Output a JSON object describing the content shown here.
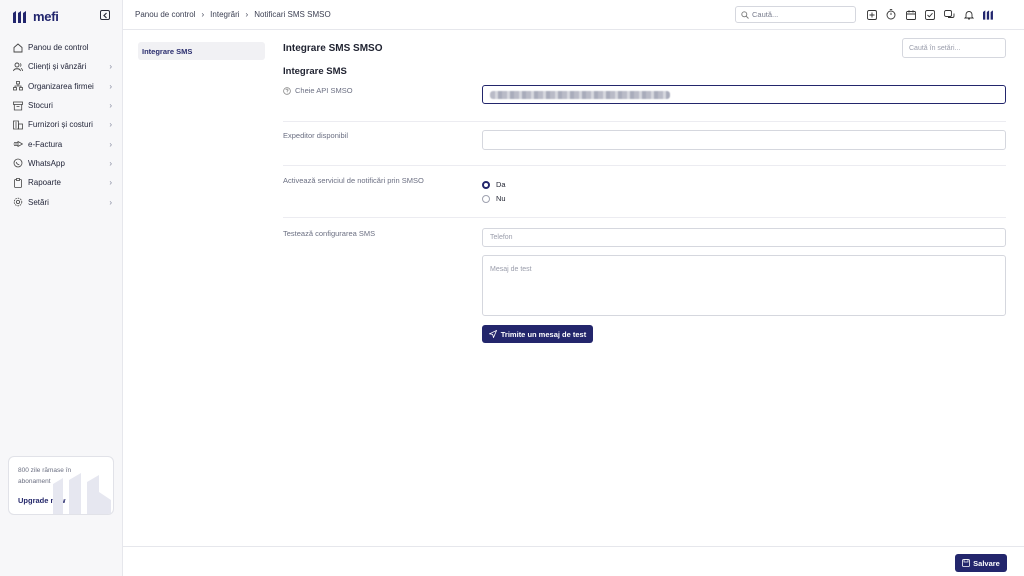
{
  "app": {
    "name": "mefi"
  },
  "sidebar": {
    "items": [
      {
        "label": "Panou de control",
        "icon": "home-icon",
        "chevron": false
      },
      {
        "label": "Clienți și vânzări",
        "icon": "users-icon",
        "chevron": true
      },
      {
        "label": "Organizarea firmei",
        "icon": "org-chart-icon",
        "chevron": true
      },
      {
        "label": "Stocuri",
        "icon": "warehouse-icon",
        "chevron": true
      },
      {
        "label": "Furnizori și costuri",
        "icon": "building-icon",
        "chevron": true
      },
      {
        "label": "e-Factura",
        "icon": "efactura-icon",
        "chevron": true
      },
      {
        "label": "WhatsApp",
        "icon": "whatsapp-icon",
        "chevron": true
      },
      {
        "label": "Rapoarte",
        "icon": "clipboard-icon",
        "chevron": true
      },
      {
        "label": "Setări",
        "icon": "gear-icon",
        "chevron": true
      }
    ],
    "upgrade": {
      "days_text": "800 zile rămase în abonament",
      "link_label": "Upgrade now"
    }
  },
  "header": {
    "breadcrumbs": [
      "Panou de control",
      "Integrări",
      "Notificari SMS SMSO"
    ],
    "search_placeholder": "Caută..."
  },
  "subnav": {
    "items": [
      "Integrare SMS"
    ]
  },
  "main": {
    "title": "Integrare SMS SMSO",
    "settings_search_placeholder": "Caută în setări...",
    "section_title": "Integrare SMS",
    "api_key_label": "Cheie API SMSO",
    "sender_label": "Expeditor disponibil",
    "activate_label": "Activează serviciul de notificări prin SMSO",
    "radio_yes": "Da",
    "radio_no": "Nu",
    "radio_selected": "Da",
    "test_label": "Testează configurarea SMS",
    "phone_placeholder": "Telefon",
    "message_placeholder": "Mesaj de test",
    "send_button": "Trimite un mesaj de test"
  },
  "footer": {
    "save_button": "Salvare"
  },
  "colors": {
    "primary": "#23266c",
    "sidebar_bg": "#f7f7f9",
    "border": "#d5d7de"
  }
}
